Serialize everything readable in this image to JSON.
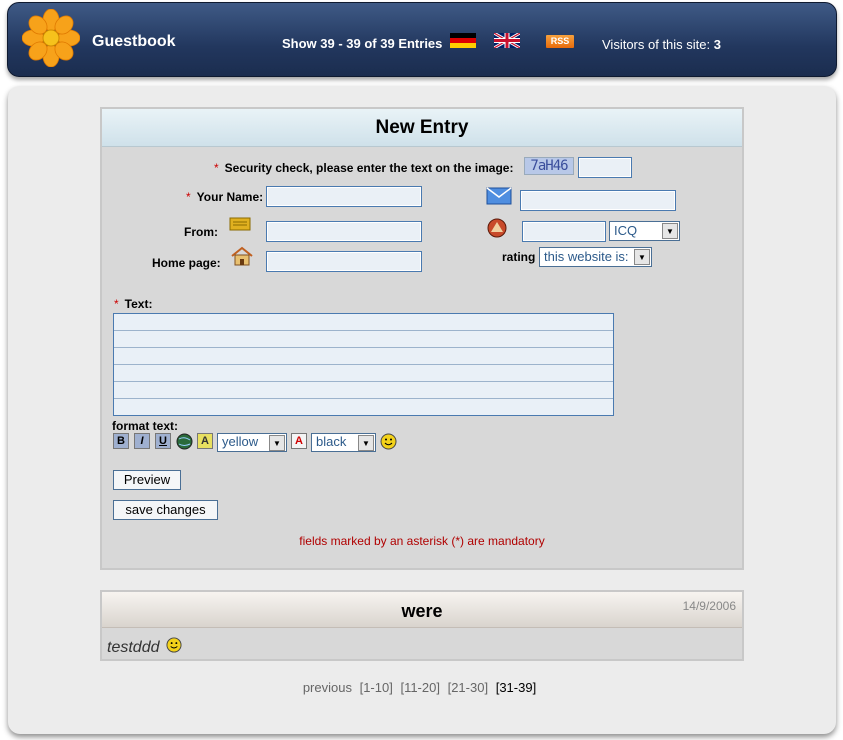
{
  "header": {
    "title": "Guestbook",
    "show_info": "Show 39 - 39 of 39 Entries",
    "rss_label": "RSS",
    "visitors_label": "Visitors of this site:",
    "visitors_count": "3"
  },
  "form": {
    "heading": "New Entry",
    "security_label": "Security check, please enter the text on the image:",
    "captcha_text": "7aH46",
    "name_label": "Your Name:",
    "from_label": "From:",
    "homepage_label": "Home page:",
    "messenger_select": "ICQ",
    "rating_label": "rating",
    "rating_select": "this website is:",
    "text_label": "Text:",
    "format_label": "format text:",
    "bg_color_select": "yellow",
    "font_color_select": "black",
    "preview_button": "Preview",
    "save_button": "save changes",
    "mandatory_note": "fields marked by an asterisk (*) are mandatory",
    "asterisk": "*"
  },
  "entry": {
    "title": "were",
    "date": "14/9/2006",
    "text": "testddd"
  },
  "pager": {
    "previous": "previous",
    "pages": [
      "[1-10]",
      "[11-20]",
      "[21-30]",
      "[31-39]"
    ]
  },
  "colors": {
    "header_bg": "#22375e",
    "accent_input_border": "#4a7ab0",
    "mandatory_text": "#b00000"
  }
}
